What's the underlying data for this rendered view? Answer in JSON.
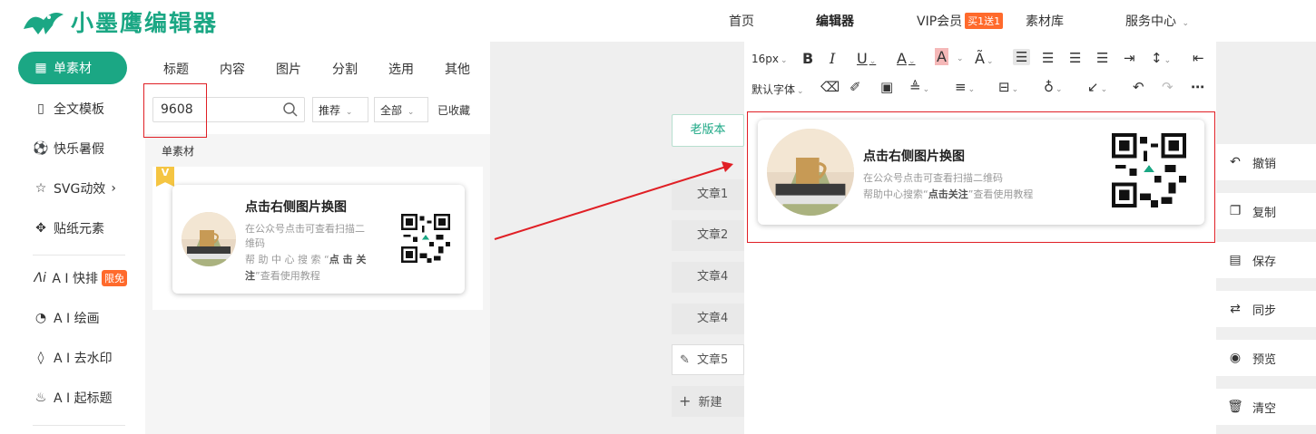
{
  "header": {
    "logo_text": "小墨鹰编辑器",
    "nav": {
      "home": "首页",
      "editor": "编辑器",
      "vip": "VIP会员",
      "vip_badge": "买1送1",
      "library": "素材库",
      "service": "服务中心"
    }
  },
  "sidebar": {
    "items": [
      {
        "label": "单素材",
        "icon": "grid-icon"
      },
      {
        "label": "全文模板",
        "icon": "template-icon"
      },
      {
        "label": "快乐暑假",
        "icon": "ball-icon"
      },
      {
        "label": "SVG动效",
        "icon": "star-icon"
      },
      {
        "label": "贴纸元素",
        "icon": "puzzle-icon"
      },
      {
        "label": "A I 快排",
        "icon": "ai-icon",
        "badge": "限免"
      },
      {
        "label": "A I 绘画",
        "icon": "palette-icon"
      },
      {
        "label": "A I 去水印",
        "icon": "drop-icon"
      },
      {
        "label": "A I 起标题",
        "icon": "fire-icon"
      }
    ]
  },
  "panel": {
    "tabs": [
      "标题",
      "内容",
      "图片",
      "分割",
      "选用",
      "其他"
    ],
    "search_value": "9608",
    "sort_label": "推荐",
    "filter_label": "全部",
    "favorites_label": "已收藏",
    "section_label": "单素材",
    "tag_letter": "V"
  },
  "card": {
    "title": "点击右侧图片换图",
    "line1_small": "在公众号点击可查看扫描二",
    "line1_small_b": "维码",
    "line2_small": "帮 助 中 心 搜 索 “",
    "line2_small_b": "点 击 关",
    "line2_small_c": "注",
    "line2_small_d": "”查看使用教程",
    "line1": "在公众号点击可查看扫描二维码",
    "line2_pre": "帮助中心搜索“",
    "line2_bold": "点击关注",
    "line2_post": "”查看使用教程"
  },
  "articles": {
    "old_version": "老版本",
    "items": [
      "文章1",
      "文章2",
      "文章4",
      "文章4",
      "文章5"
    ],
    "new": "新建"
  },
  "toolbar": {
    "font_size": "16px",
    "font_family": "默认字体"
  },
  "actions": {
    "undo": "撤销",
    "copy": "复制",
    "save": "保存",
    "sync": "同步",
    "preview": "预览",
    "clear": "清空"
  },
  "colors": {
    "brand": "#1ba784",
    "badge": "#ff6a2c",
    "highlight": "#e01f25"
  }
}
